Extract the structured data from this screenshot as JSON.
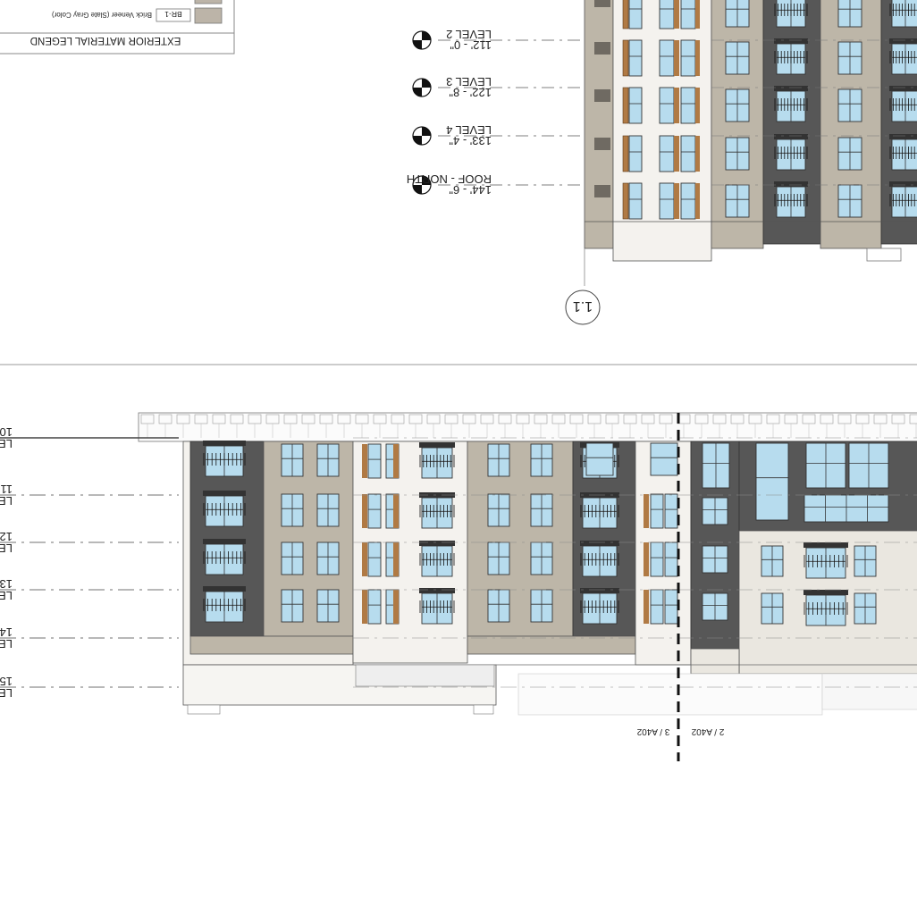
{
  "legend": {
    "title": "EXTERIOR MATERIAL LEGEND",
    "items": [
      {
        "code": "BR-1",
        "description": "Brick Veneer (Slate Gray Color)",
        "swatch": "#bcb4a8"
      }
    ]
  },
  "top_elevation": {
    "gridline_bubble": "1.1",
    "levels": [
      {
        "name": "LEVEL 2",
        "elevation": "112' - 0\""
      },
      {
        "name": "LEVEL 3",
        "elevation": "122' - 8\""
      },
      {
        "name": "LEVEL 4",
        "elevation": "133' - 4\""
      },
      {
        "name": "ROOF - NORTH",
        "elevation": "144' - 6\""
      }
    ]
  },
  "bottom_elevation": {
    "match_line_left": "3 / A402",
    "match_line_right": "2 / A402",
    "cropped_level_tags": [
      "LE",
      "LE",
      "LE",
      "LE",
      "LE",
      "LE"
    ],
    "cropped_level_digits": [
      "10",
      "11",
      "12",
      "13",
      "14",
      "15"
    ]
  },
  "colors": {
    "brick_tan": "#bdb6a8",
    "charcoal": "#575757",
    "stucco": "#f4f2ee",
    "light_stucco": "#e6e3dc",
    "wood": "#b07a44",
    "glass": "#b7dcee",
    "line": "#222222"
  }
}
